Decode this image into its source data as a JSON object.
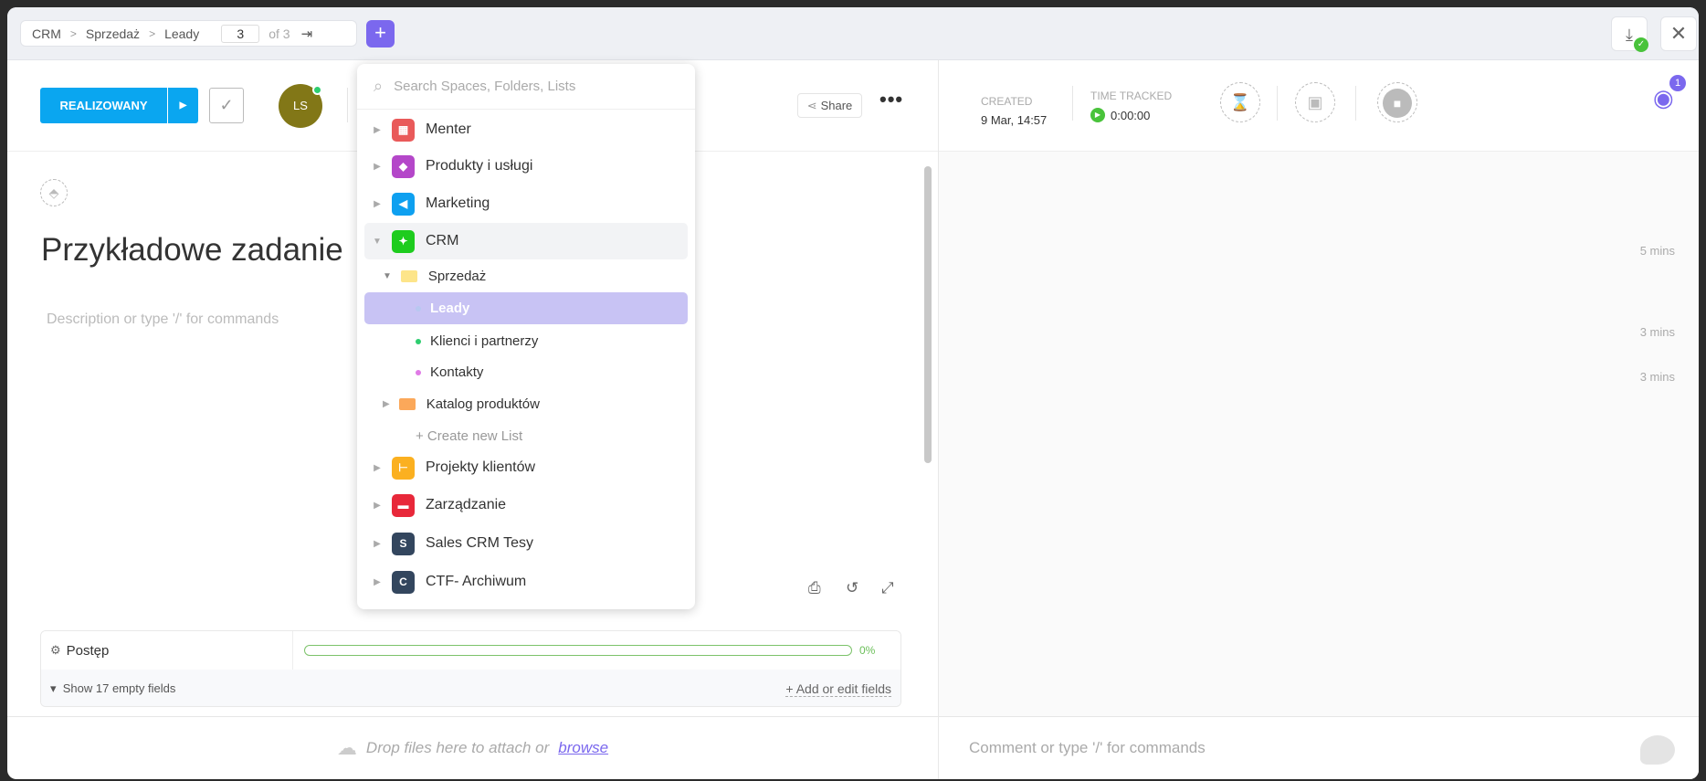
{
  "breadcrumb": {
    "items": [
      "CRM",
      "Sprzedaż",
      "Leady"
    ],
    "page": "3",
    "of": "of 3"
  },
  "header": {
    "status": "REALIZOWANY",
    "status_color": "#0aa6f0",
    "avatar_initials": "LS",
    "share": "Share"
  },
  "task": {
    "title": "Przykładowe zadanie",
    "description_placeholder": "Description or type '/' for commands"
  },
  "fields": {
    "name": "Postęp",
    "progress_percent": 0,
    "progress_label": "0%",
    "show_empty": "Show 17 empty fields",
    "add_edit": "+ Add or edit fields"
  },
  "attach": {
    "text": "Drop files here to attach or",
    "link": "browse"
  },
  "meta": {
    "created_label": "CREATED",
    "created_value": "9 Mar, 14:57",
    "time_label": "TIME TRACKED",
    "time_value": "0:00:00",
    "watchers": "1"
  },
  "activity": {
    "timestamps": [
      "5 mins",
      "3 mins",
      "3 mins"
    ]
  },
  "comment": {
    "placeholder": "Comment or type '/' for commands"
  },
  "dropdown": {
    "search_placeholder": "Search Spaces, Folders, Lists",
    "spaces": [
      {
        "label": "Menter",
        "color": "#e95a5a"
      },
      {
        "label": "Produkty i usługi",
        "color": "#b447c9"
      },
      {
        "label": "Marketing",
        "color": "#0ea0f0"
      },
      {
        "label": "CRM",
        "color": "#1ecc1e"
      }
    ],
    "folder": "Sprzedaż",
    "lists": [
      {
        "label": "Leady",
        "color": "#b8c8f0"
      },
      {
        "label": "Klienci i partnerzy",
        "color": "#2ecd6f"
      },
      {
        "label": "Kontakty",
        "color": "#e07ae6"
      }
    ],
    "folder2": "Katalog produktów",
    "create_list": "+ Create new List",
    "spaces2": [
      {
        "label": "Projekty klientów",
        "color": "#fbb020",
        "letter": ""
      },
      {
        "label": "Zarządzanie",
        "color": "#e8283a",
        "letter": ""
      },
      {
        "label": "Sales CRM Tesy",
        "color": "#33465e",
        "letter": "S"
      },
      {
        "label": "CTF- Archiwum",
        "color": "#33465e",
        "letter": "C"
      }
    ]
  }
}
